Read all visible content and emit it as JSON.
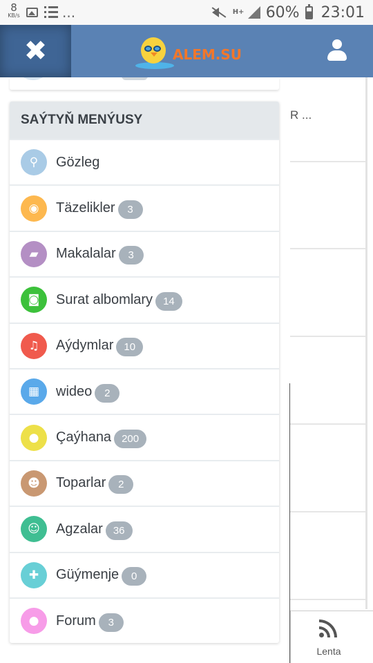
{
  "status_bar": {
    "speed_value": "8",
    "speed_unit": "KB/s",
    "dots": "...",
    "data_indicator": "H+",
    "battery_pct": "60%",
    "time": "23:01"
  },
  "header": {
    "close_glyph": "✖",
    "logo_text": "ALEM.SU",
    "colors": {
      "header_bg": "#5a82b4",
      "close_bg": "#3f6595",
      "logo_text": "#f2772a"
    }
  },
  "background_page": {
    "snippet": "R ...",
    "tab_label": "Lenta"
  },
  "menu": {
    "title": "SAÝTYŇ MENÝUSY",
    "items": [
      {
        "label": "Gözleg",
        "badge": null,
        "icon": "search-icon",
        "glyph": "⚲",
        "color": "#a9cbe6"
      },
      {
        "label": "Täzelikler",
        "badge": "3",
        "icon": "rss-icon",
        "glyph": "◉",
        "color": "#fdb84f"
      },
      {
        "label": "Makalalar",
        "badge": "3",
        "icon": "book-icon",
        "glyph": "▰",
        "color": "#b48fc4"
      },
      {
        "label": "Surat albomlary",
        "badge": "14",
        "icon": "camera-icon",
        "glyph": "◙",
        "color": "#3cc13b"
      },
      {
        "label": "Aýdymlar",
        "badge": "10",
        "icon": "music-icon",
        "glyph": "♫",
        "color": "#f05a4d"
      },
      {
        "label": "wideo",
        "badge": "2",
        "icon": "film-icon",
        "glyph": "▦",
        "color": "#5aa9ea"
      },
      {
        "label": "Çaýhana",
        "badge": "200",
        "icon": "chat-bubble-icon",
        "glyph": "●",
        "color": "#ede049"
      },
      {
        "label": "Toparlar",
        "badge": "2",
        "icon": "group-icon",
        "glyph": "☻",
        "color": "#c99872"
      },
      {
        "label": "Agzalar",
        "badge": "36",
        "icon": "user-icon",
        "glyph": "☺",
        "color": "#3fbe92"
      },
      {
        "label": "Güýmenje",
        "badge": "0",
        "icon": "gamepad-icon",
        "glyph": "✚",
        "color": "#68cfd6"
      },
      {
        "label": "Forum",
        "badge": "3",
        "icon": "forum-icon",
        "glyph": "●",
        "color": "#f79ce8"
      }
    ]
  }
}
